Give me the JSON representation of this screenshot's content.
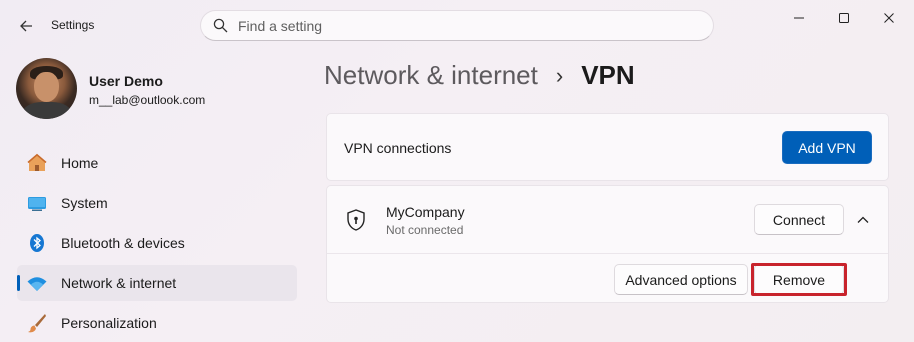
{
  "window": {
    "title": "Settings",
    "controls": [
      "minimize-icon",
      "maximize-icon",
      "close-icon"
    ]
  },
  "search": {
    "placeholder": "Find a setting",
    "value": ""
  },
  "profile": {
    "name": "User Demo",
    "email": "m__lab@outlook.com"
  },
  "sidebar": {
    "items": [
      {
        "label": "Home",
        "icon": "home-icon",
        "active": false
      },
      {
        "label": "System",
        "icon": "system-icon",
        "active": false
      },
      {
        "label": "Bluetooth & devices",
        "icon": "bluetooth-icon",
        "active": false
      },
      {
        "label": "Network & internet",
        "icon": "wifi-icon",
        "active": true
      },
      {
        "label": "Personalization",
        "icon": "brush-icon",
        "active": false
      }
    ]
  },
  "breadcrumb": {
    "parent": "Network & internet",
    "separator": "›",
    "current": "VPN"
  },
  "vpn": {
    "section_label": "VPN connections",
    "add_button": "Add VPN",
    "connection": {
      "name": "MyCompany",
      "status": "Not connected",
      "connect_button": "Connect",
      "advanced_button": "Advanced options",
      "remove_button": "Remove",
      "expanded": true
    }
  },
  "colors": {
    "accent": "#005fb8",
    "highlight": "#c8232c"
  }
}
